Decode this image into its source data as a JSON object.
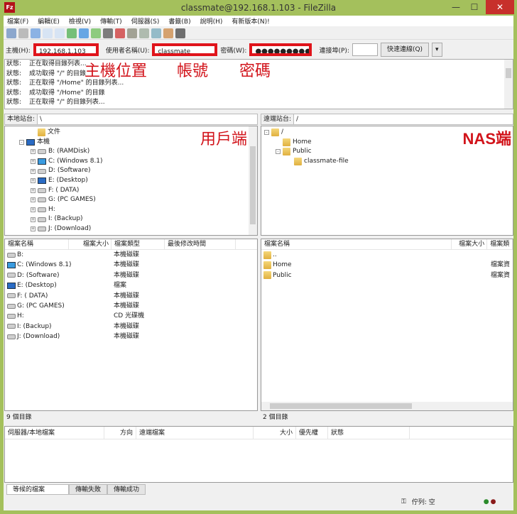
{
  "window": {
    "title": "classmate@192.168.1.103 - FileZilla",
    "app_icon": "Fz",
    "minimize": "—",
    "maximize": "☐",
    "close": "✕"
  },
  "menu": [
    "檔案(F)",
    "編輯(E)",
    "檢視(V)",
    "傳輸(T)",
    "伺服器(S)",
    "書籤(B)",
    "說明(H)",
    "有新版本(N)!"
  ],
  "quickconnect": {
    "host_label": "主機(H):",
    "host": "192.168.1.103",
    "user_label": "使用者名稱(U):",
    "user": "classmate",
    "pass_label": "密碼(W):",
    "pass": "●●●●●●●●●",
    "port_label": "連接埠(P):",
    "port": "",
    "connect": "快速連線(Q)",
    "dropdown": "▾"
  },
  "log": [
    {
      "k": "狀態:",
      "v": "正在取得目錄列表..."
    },
    {
      "k": "狀態:",
      "v": "成功取得 \"/\" 的目錄"
    },
    {
      "k": "狀態:",
      "v": "正在取得 \"/Home\" 的目錄列表..."
    },
    {
      "k": "狀態:",
      "v": "成功取得 \"/Home\" 的目錄"
    },
    {
      "k": "狀態:",
      "v": "正在取得 \"/\" 的目錄列表..."
    }
  ],
  "annotations": {
    "host": "主機位置",
    "user": "帳號",
    "pass": "密碼",
    "local": "用戶端",
    "remote": "NAS端"
  },
  "local": {
    "site_label": "本地站台:",
    "path": "\\",
    "tree": [
      {
        "t": "文件",
        "i": "folder",
        "d": 2,
        "e": ""
      },
      {
        "t": "本機",
        "i": "mon",
        "d": 1,
        "e": "-"
      },
      {
        "t": "B: (RAMDisk)",
        "i": "drive",
        "d": 2,
        "e": "+"
      },
      {
        "t": "C: (Windows 8.1)",
        "i": "win",
        "d": 2,
        "e": "+"
      },
      {
        "t": "D: (Software)",
        "i": "drive",
        "d": 2,
        "e": "+"
      },
      {
        "t": "E: (Desktop)",
        "i": "mon",
        "d": 2,
        "e": "+"
      },
      {
        "t": "F: ( DATA)",
        "i": "drive",
        "d": 2,
        "e": "+"
      },
      {
        "t": "G: (PC GAMES)",
        "i": "drive",
        "d": 2,
        "e": "+"
      },
      {
        "t": "H:",
        "i": "cd",
        "d": 2,
        "e": "+"
      },
      {
        "t": "I: (Backup)",
        "i": "drive",
        "d": 2,
        "e": "+"
      },
      {
        "t": "J: (Download)",
        "i": "drive",
        "d": 2,
        "e": "+"
      }
    ],
    "columns": [
      "檔案名稱",
      "檔案大小",
      "檔案類型",
      "最後修改時間"
    ],
    "files": [
      {
        "n": "B:",
        "t": "本機磁碟",
        "i": "drive"
      },
      {
        "n": "C: (Windows 8.1)",
        "t": "本機磁碟",
        "i": "win"
      },
      {
        "n": "D: (Software)",
        "t": "本機磁碟",
        "i": "drive"
      },
      {
        "n": "E: (Desktop)",
        "t": "檔案",
        "i": "mon"
      },
      {
        "n": "F: ( DATA)",
        "t": "本機磁碟",
        "i": "drive"
      },
      {
        "n": "G: (PC GAMES)",
        "t": "本機磁碟",
        "i": "drive"
      },
      {
        "n": "H:",
        "t": "CD 光碟機",
        "i": "cd"
      },
      {
        "n": "I: (Backup)",
        "t": "本機磁碟",
        "i": "drive"
      },
      {
        "n": "J: (Download)",
        "t": "本機磁碟",
        "i": "drive"
      }
    ],
    "status": "9 個目錄"
  },
  "remote": {
    "site_label": "遠端站台:",
    "path": "/",
    "tree": [
      {
        "t": "/",
        "d": 0,
        "e": "-"
      },
      {
        "t": "Home",
        "d": 1,
        "e": ""
      },
      {
        "t": "Public",
        "d": 1,
        "e": "-"
      },
      {
        "t": "classmate-file",
        "d": 2,
        "e": ""
      }
    ],
    "columns": [
      "檔案名稱",
      "檔案大小",
      "檔案類"
    ],
    "files": [
      {
        "n": "..",
        "t": ""
      },
      {
        "n": "Home",
        "t": "檔案資"
      },
      {
        "n": "Public",
        "t": "檔案資"
      }
    ],
    "status": "2 個目錄"
  },
  "queue": {
    "columns": [
      "伺服器/本地檔案",
      "方向",
      "遠端檔案",
      "大小",
      "優先權",
      "狀態"
    ],
    "tabs": [
      "等候的檔案",
      "傳輸失敗",
      "傳輸成功"
    ],
    "status": "佇列: 空"
  },
  "colors": {
    "frame": "#a4c05c",
    "highlight": "#e0141b"
  }
}
